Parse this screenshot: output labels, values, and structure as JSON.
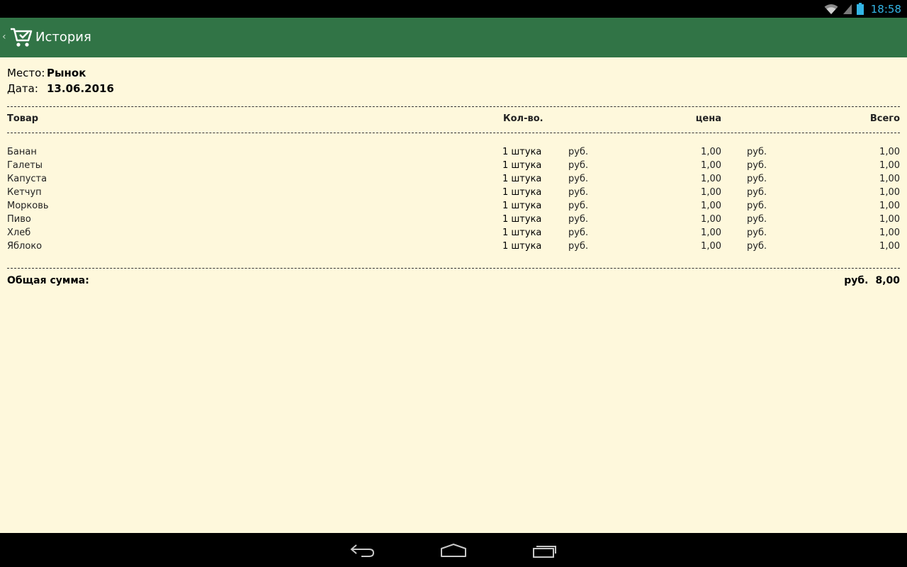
{
  "status_bar": {
    "time": "18:58",
    "icons": [
      "wifi-icon",
      "cell-signal-icon",
      "battery-icon"
    ]
  },
  "action_bar": {
    "title": "История",
    "icon": "cart-icon",
    "background": "#317446"
  },
  "receipt": {
    "place_label": "Место:",
    "place_value": "Рынок",
    "date_label": "Дата:",
    "date_value": "13.06.2016",
    "headers": {
      "item": "Товар",
      "qty": "Кол-во.",
      "price": "цена",
      "total": "Всего"
    },
    "rows": [
      {
        "name": "Банан",
        "qty": "1 штука",
        "cur1": "руб.",
        "price": "1,00",
        "cur2": "руб.",
        "total": "1,00"
      },
      {
        "name": "Галеты",
        "qty": "1 штука",
        "cur1": "руб.",
        "price": "1,00",
        "cur2": "руб.",
        "total": "1,00"
      },
      {
        "name": "Капуста",
        "qty": "1 штука",
        "cur1": "руб.",
        "price": "1,00",
        "cur2": "руб.",
        "total": "1,00"
      },
      {
        "name": "Кетчуп",
        "qty": "1 штука",
        "cur1": "руб.",
        "price": "1,00",
        "cur2": "руб.",
        "total": "1,00"
      },
      {
        "name": "Морковь",
        "qty": "1 штука",
        "cur1": "руб.",
        "price": "1,00",
        "cur2": "руб.",
        "total": "1,00"
      },
      {
        "name": "Пиво",
        "qty": "1 штука",
        "cur1": "руб.",
        "price": "1,00",
        "cur2": "руб.",
        "total": "1,00"
      },
      {
        "name": "Хлеб",
        "qty": "1 штука",
        "cur1": "руб.",
        "price": "1,00",
        "cur2": "руб.",
        "total": "1,00"
      },
      {
        "name": "Яблоко",
        "qty": "1 штука",
        "cur1": "руб.",
        "price": "1,00",
        "cur2": "руб.",
        "total": "1,00"
      }
    ],
    "sum_label": "Общая сумма:",
    "sum_currency": "руб.",
    "sum_value": "8,00",
    "background": "#fef8dc"
  },
  "nav_bar": {
    "buttons": [
      "back-icon",
      "home-icon",
      "recent-apps-icon"
    ]
  }
}
